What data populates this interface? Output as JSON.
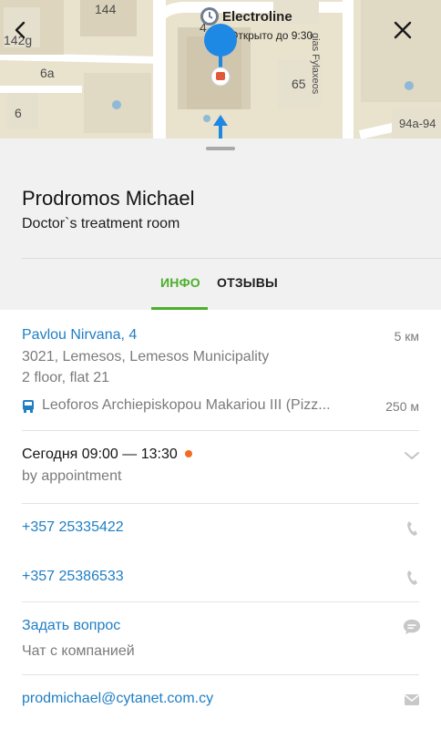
{
  "map": {
    "labels": {
      "b144": "144",
      "b142": "142g",
      "b6a": "6a",
      "b6": "6",
      "b4": "4",
      "b65": "65",
      "b94": "94a-94",
      "street": "gias Fylaxeos"
    },
    "poi": {
      "name": "Electroline",
      "status": "Открыто до 9:30"
    },
    "icons": {
      "back": "chevron-left-icon",
      "close": "close-icon",
      "pin": "location-pin-icon"
    }
  },
  "place": {
    "name": "Prodromos Michael",
    "category": "Doctor`s treatment room"
  },
  "tabs": [
    {
      "label": "ИНФО",
      "active": true
    },
    {
      "label": "ОТЗЫВЫ",
      "active": false
    }
  ],
  "address": {
    "street": "Pavlou Nirvana, 4",
    "distance": "5 км",
    "city": "3021, Lemesos, Lemesos Municipality",
    "floor": "2 floor, flat 21",
    "transit_stop": "Leoforos Archiepiskopou Makariou III (Pizz...",
    "transit_distance": "250 м"
  },
  "hours": {
    "today": "Сегодня 09:00 — 13:30",
    "note": "by appointment"
  },
  "phones": [
    "+357 25335422",
    "+357 25386533"
  ],
  "chat": {
    "title": "Задать вопрос",
    "subtitle": "Чат с компанией"
  },
  "email": "prodmichael@cytanet.com.cy",
  "colors": {
    "accent_green": "#4caf2a",
    "link_blue": "#1f7ec4",
    "status_orange": "#f26b21",
    "pin_blue": "#1e88e5"
  }
}
